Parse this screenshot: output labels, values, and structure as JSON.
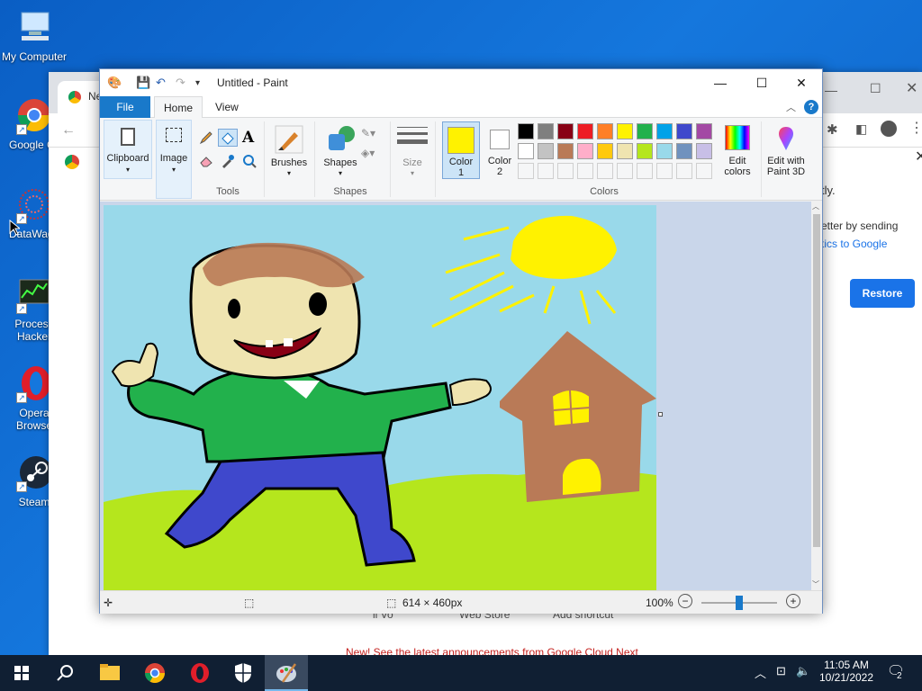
{
  "desktop": {
    "icons": [
      {
        "label": "My Computer"
      },
      {
        "label": "Google Chrom"
      },
      {
        "label": "DataWago"
      },
      {
        "label": "Process Hacker"
      },
      {
        "label": "Opera Browse"
      },
      {
        "label": "Steam"
      }
    ]
  },
  "chrome": {
    "tab_title": "Ne",
    "text_partial": "tly.",
    "text_line1": "etter by sending",
    "text_line2": "tics to Google",
    "restore_label": "Restore",
    "bottom_links": [
      "ll Vo",
      "Web Store",
      "Add shortcut"
    ],
    "notice": "New! See the latest announcements from Google Cloud Next"
  },
  "paint": {
    "title": "Untitled - Paint",
    "tabs": {
      "file": "File",
      "home": "Home",
      "view": "View"
    },
    "ribbon": {
      "clipboard": "Clipboard",
      "image": "Image",
      "tools": "Tools",
      "brushes": "Brushes",
      "shapes": "Shapes",
      "shapes_group": "Shapes",
      "size": "Size",
      "color1": "Color\n1",
      "color1_a": "Color",
      "color1_b": "1",
      "color2_a": "Color",
      "color2_b": "2",
      "colors_group": "Colors",
      "edit_colors_a": "Edit",
      "edit_colors_b": "colors",
      "paint3d_a": "Edit with",
      "paint3d_b": "Paint 3D"
    },
    "color1_value": "#fff200",
    "color2_value": "#ffffff",
    "palette_row1": [
      "#000000",
      "#7f7f7f",
      "#880015",
      "#ed1c24",
      "#ff7f27",
      "#fff200",
      "#22b14c",
      "#00a2e8",
      "#3f48cc",
      "#a349a4"
    ],
    "palette_row2": [
      "#ffffff",
      "#c3c3c3",
      "#b97a57",
      "#ffaec9",
      "#ffc90e",
      "#efe4b0",
      "#b5e61d",
      "#99d9ea",
      "#7092be",
      "#c8bfe7"
    ],
    "status": {
      "image_size": "614 × 460px",
      "zoom": "100%",
      "zoom_level": 0.5
    }
  },
  "taskbar": {
    "time": "11:05 AM",
    "date": "10/21/2022",
    "notifications": "2"
  }
}
